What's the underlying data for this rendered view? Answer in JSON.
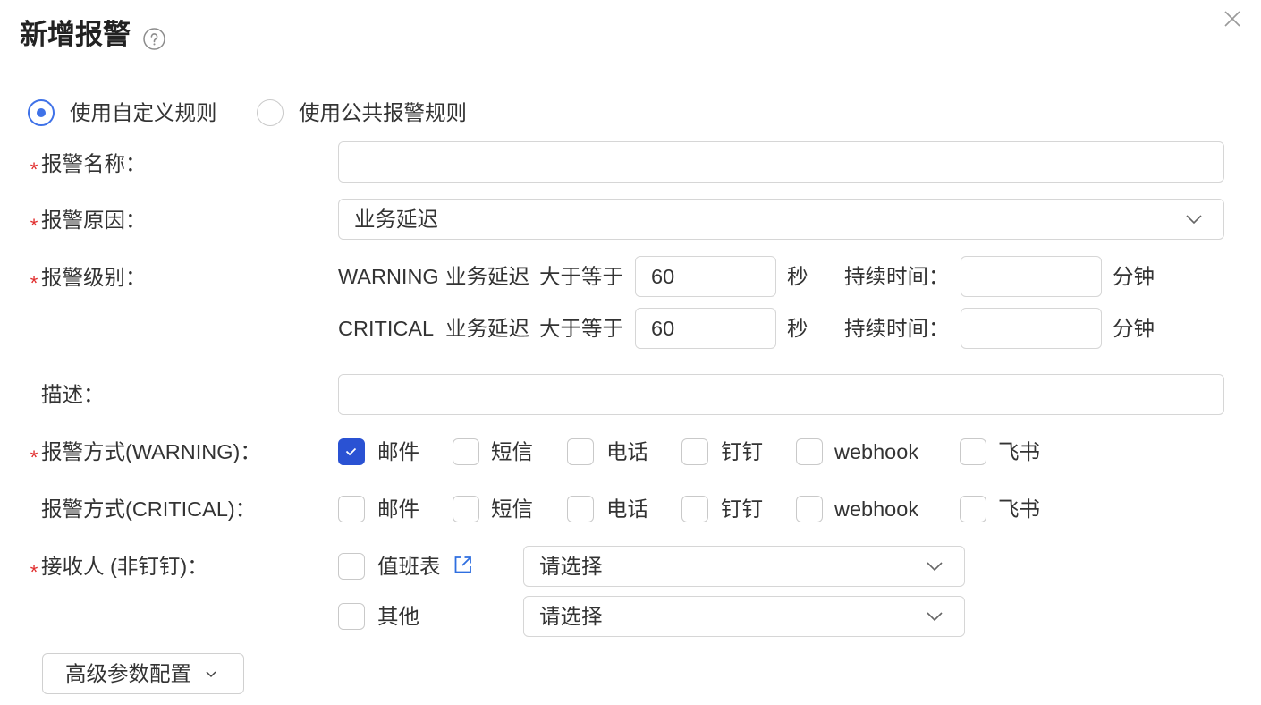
{
  "dialog": {
    "title": "新增报警",
    "help_icon": "question-circle-icon",
    "close_icon": "close-icon"
  },
  "colors": {
    "accent": "#2a52d3",
    "radio": "#3f72e8",
    "required_mark": "#e02b2b",
    "link": "#2f6fe0",
    "text": "#333333",
    "border": "#d6d6d6"
  },
  "rule_type": [
    {
      "label": "使用自定义规则",
      "selected": true
    },
    {
      "label": "使用公共报警规则",
      "selected": false
    }
  ],
  "form": {
    "required_mark": "*",
    "name": {
      "label": "报警名称：",
      "required": true,
      "value": ""
    },
    "reason": {
      "label": "报警原因：",
      "required": true,
      "value": "业务延迟",
      "icon": "chevron-down-icon"
    },
    "level": {
      "label": "报警级别：",
      "required": true,
      "rows": [
        {
          "level": "WARNING",
          "metric": "业务延迟",
          "operator": "大于等于",
          "threshold": "60",
          "unit": "秒",
          "duration_label": "持续时间：",
          "duration": "",
          "duration_unit": "分钟"
        },
        {
          "level": "CRITICAL",
          "metric": "业务延迟",
          "operator": "大于等于",
          "threshold": "60",
          "unit": "秒",
          "duration_label": "持续时间：",
          "duration": "",
          "duration_unit": "分钟"
        }
      ]
    },
    "description": {
      "label": "描述：",
      "required": false,
      "value": ""
    },
    "notify_warning": {
      "label": "报警方式(WARNING)：",
      "required": true,
      "options": [
        {
          "label": "邮件",
          "checked": true
        },
        {
          "label": "短信",
          "checked": false
        },
        {
          "label": "电话",
          "checked": false
        },
        {
          "label": "钉钉",
          "checked": false
        },
        {
          "label": "webhook",
          "checked": false
        },
        {
          "label": "飞书",
          "checked": false
        }
      ]
    },
    "notify_critical": {
      "label": "报警方式(CRITICAL)：",
      "required": false,
      "options": [
        {
          "label": "邮件",
          "checked": false
        },
        {
          "label": "短信",
          "checked": false
        },
        {
          "label": "电话",
          "checked": false
        },
        {
          "label": "钉钉",
          "checked": false
        },
        {
          "label": "webhook",
          "checked": false
        },
        {
          "label": "飞书",
          "checked": false
        }
      ]
    },
    "receivers": {
      "label": "接收人 (非钉钉)：",
      "required": true,
      "items": [
        {
          "label": "值班表",
          "checked": false,
          "link_icon": "external-link-icon",
          "select_placeholder": "请选择",
          "select_icon": "chevron-down-icon"
        },
        {
          "label": "其他",
          "checked": false,
          "select_placeholder": "请选择",
          "select_icon": "chevron-down-icon"
        }
      ]
    }
  },
  "advanced_button": {
    "label": "高级参数配置",
    "icon": "chevron-down-icon"
  }
}
